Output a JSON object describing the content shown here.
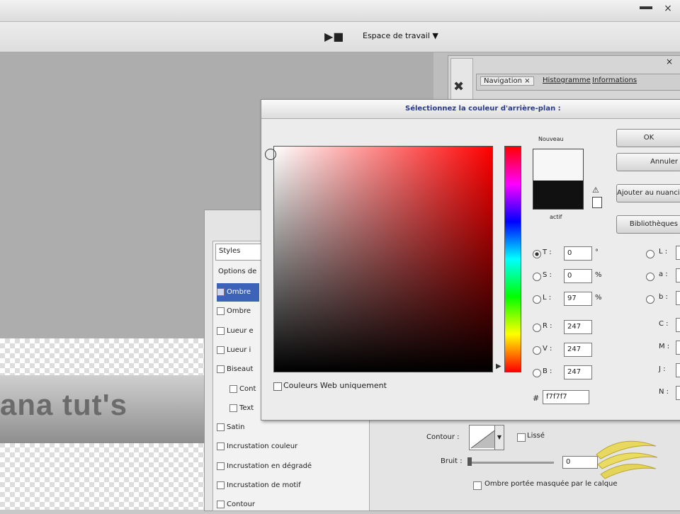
{
  "app": {
    "workspace_label": "Espace de travail ▼",
    "close_symbol": "×"
  },
  "canvas": {
    "banner_text": "ana tut's"
  },
  "panel": {
    "tabs": [
      "Navigation ×",
      "Histogramme",
      "Informations"
    ],
    "close_symbol": "×"
  },
  "layer_style": {
    "styles_header": "Styles",
    "options_label": "Options de",
    "items": [
      {
        "label": "Ombre",
        "checked": true,
        "selected": true
      },
      {
        "label": "Ombre",
        "checked": false
      },
      {
        "label": "Lueur e",
        "checked": false
      },
      {
        "label": "Lueur i",
        "checked": false
      },
      {
        "label": "Biseaut",
        "checked": false
      },
      {
        "label": "Cont",
        "checked": false,
        "indent": true
      },
      {
        "label": "Text",
        "checked": false,
        "indent": true
      },
      {
        "label": "Satin",
        "checked": false
      },
      {
        "label": "Incrustation couleur",
        "checked": false
      },
      {
        "label": "Incrustation en dégradé",
        "checked": false
      },
      {
        "label": "Incrustation de motif",
        "checked": false
      },
      {
        "label": "Contour",
        "checked": false
      }
    ],
    "contour_label": "Contour :",
    "lisse_label": "Lissé",
    "bruit_label": "Bruit :",
    "bruit_value": "0",
    "shadow_option": "Ombre portée masquée par le calque"
  },
  "color_picker": {
    "title": "Sélectionnez la couleur d'arrière-plan :",
    "new_label": "Nouveau",
    "current_label": "actif",
    "buttons": {
      "ok": "OK",
      "cancel": "Annuler",
      "add_swatch": "Ajouter au nuancier",
      "libraries": "Bibliothèques"
    },
    "fields_left": [
      {
        "label": "T :",
        "value": "0",
        "unit": "°",
        "selected": true
      },
      {
        "label": "S :",
        "value": "0",
        "unit": "%",
        "selected": false
      },
      {
        "label": "L :",
        "value": "97",
        "unit": "%",
        "selected": false
      },
      {
        "label": "R :",
        "value": "247",
        "unit": "",
        "selected": false
      },
      {
        "label": "V :",
        "value": "247",
        "unit": "",
        "selected": false
      },
      {
        "label": "B :",
        "value": "247",
        "unit": "",
        "selected": false
      }
    ],
    "fields_right": [
      {
        "label": "L :"
      },
      {
        "label": "a :"
      },
      {
        "label": "b :"
      },
      {
        "label": "C :"
      },
      {
        "label": "M :"
      },
      {
        "label": "J :"
      },
      {
        "label": "N :"
      }
    ],
    "hex_label": "#",
    "hex_value": "f7f7f7",
    "web_only_label": "Couleurs Web uniquement",
    "new_color": "#f7f7f7",
    "current_color": "#111111"
  }
}
